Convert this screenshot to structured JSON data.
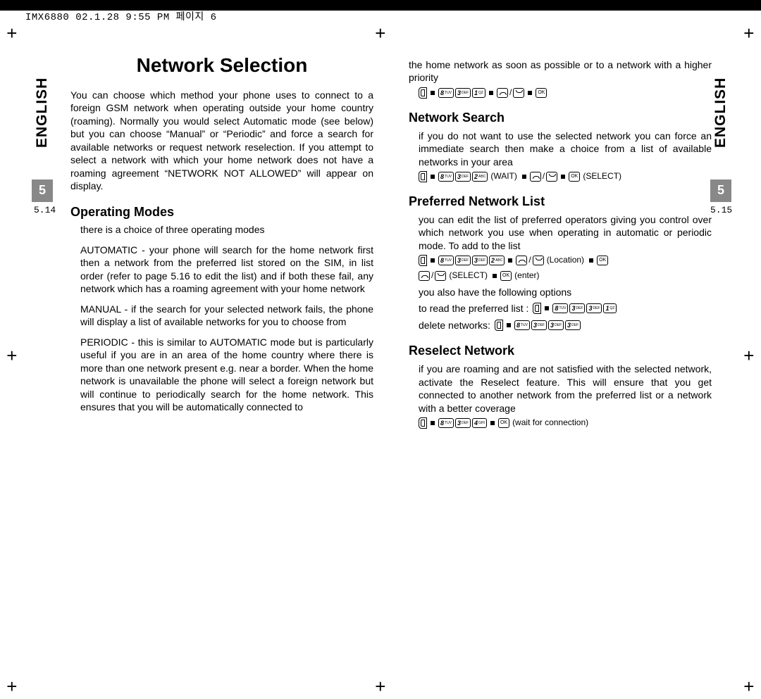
{
  "imprint": "IMX6880 02.1.28 9:55 PM    페이지 6",
  "crop_marks": {
    "tl": "+",
    "tr": "+",
    "tc": "+",
    "bl": "+",
    "br": "+",
    "bc": "+",
    "ml": "+",
    "mr": "+"
  },
  "edge_left": {
    "lang": "ENGLISH",
    "chapter": "5",
    "page": "5.14"
  },
  "edge_right": {
    "lang": "ENGLISH",
    "chapter": "5",
    "page": "5.15"
  },
  "left": {
    "title": "Network Selection",
    "intro": "You can choose which method your phone uses to connect to a foreign GSM network when operating outside your home country (roaming). Normally you would select Automatic mode (see below) but you can choose “Manual” or “Periodic” and force a search for available networks or request network reselection. If you attempt to select a network with which your home network does not have a roaming agreement “NETWORK NOT ALLOWED” will appear on display.",
    "h_op": "Operating Modes",
    "op_intro": "there is a choice of three operating modes",
    "op_auto": "AUTOMATIC - your phone will search for the home network first then a network from the preferred list stored on the SIM, in list order (refer to page 5.16 to edit the list) and if both these fail, any network which has a roaming agreement with your home network",
    "op_manual": "MANUAL - if the search for your selected network fails, the phone will display a list of available networks for you to choose from",
    "op_periodic": "PERIODIC - this is similar to AUTOMATIC mode but is particularly useful if you are in an area of the home country where there is more than one network present e.g. near a border. When the home network is unavailable the phone will select a foreign network but will continue to periodically search for the home network. This ensures that you will be automatically connected to"
  },
  "right": {
    "cont": "the home network as soon as possible or to a network with a higher priority",
    "h_search": "Network Search",
    "search_body": "if you do not want to use the selected network you can force an immediate search then make a choice from a list of available networks in your area",
    "wait": "(WAIT)",
    "select": "(SELECT)",
    "h_pref": "Preferred Network List",
    "pref_body": "you can edit the list of preferred operators giving you control over which network you use when operating in automatic or periodic mode. To add to the list",
    "location": "(Location)",
    "select2": "(SELECT)",
    "enter": "(enter)",
    "pref_also": "you also have the following options",
    "pref_read": "to read the preferred list :",
    "pref_del": "delete networks:",
    "h_reselect": "Reselect Network",
    "reselect_body": "if you are roaming and are not satisfied with the selected network, activate the Reselect feature. This will ensure that you get connected to another network from the preferred list or a network with a better coverage",
    "wait_conn": "(wait for connection)"
  },
  "keys": {
    "k8": {
      "big": "8",
      "sub": "TUV"
    },
    "k3": {
      "big": "3",
      "sub": "DEF"
    },
    "k2": {
      "big": "2",
      "sub": "ABC"
    },
    "k1": {
      "big": "1",
      "sub": "QZ"
    },
    "k4": {
      "big": "4",
      "sub": "GHI"
    }
  }
}
